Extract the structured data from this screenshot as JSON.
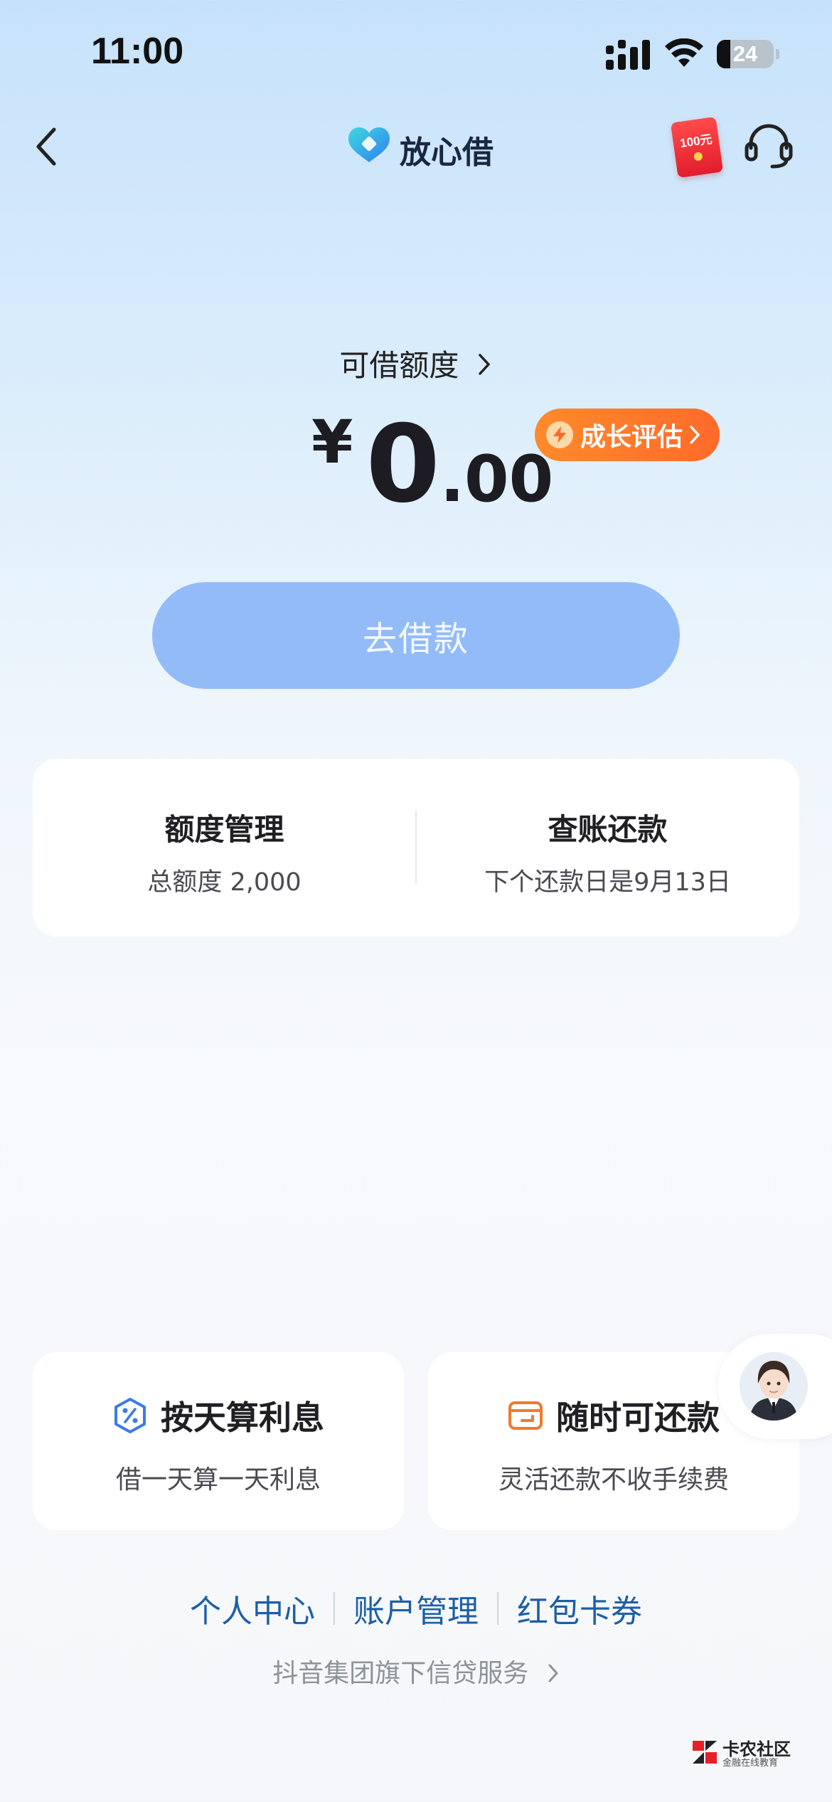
{
  "status_bar": {
    "time": "11:00",
    "battery_level": "24"
  },
  "nav": {
    "app_name": "放心借",
    "red_packet_label": "100元",
    "icons": {
      "back": "chevron-left-icon",
      "customer_service": "headset-icon",
      "red_packet": "red-packet-icon"
    }
  },
  "credit": {
    "label": "可借额度",
    "currency_symbol": "¥",
    "amount_integer": "0",
    "amount_decimal": ".00",
    "growth_badge": "成长评估"
  },
  "borrow_button": {
    "label": "去借款"
  },
  "info_card": {
    "limit_title": "额度管理",
    "limit_subtitle": "总额度 2,000",
    "repay_title": "查账还款",
    "repay_subtitle": "下个还款日是9月13日"
  },
  "features": [
    {
      "title": "按天算利息",
      "subtitle": "借一天算一天利息",
      "icon": "percent-shield-icon"
    },
    {
      "title": "随时可还款",
      "subtitle": "灵活还款不收手续费",
      "icon": "wallet-icon"
    }
  ],
  "bottom_links": [
    "个人中心",
    "账户管理",
    "红包卡券"
  ],
  "footer_service": "抖音集团旗下信贷服务",
  "watermark": {
    "title": "卡农社区",
    "subtitle": "金融在线教育"
  },
  "colors": {
    "accent_blue": "#93bbf8",
    "growth_orange": "#ff7a2a",
    "link_blue": "#1c5fa8",
    "feature_icon_blue": "#3b7be8",
    "feature_icon_orange": "#f07a2b"
  }
}
